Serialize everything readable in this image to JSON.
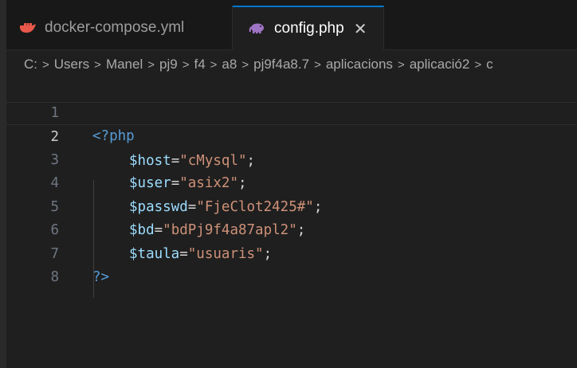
{
  "tabs": [
    {
      "label": "docker-compose.yml",
      "icon": "docker-whale-icon",
      "active": false
    },
    {
      "label": "config.php",
      "icon": "php-elephant-icon",
      "active": true,
      "close": "✕"
    }
  ],
  "breadcrumb": [
    "C:",
    "Users",
    "Manel",
    "pj9",
    "f4",
    "a8",
    "pj9f4a8.7",
    "aplicacions",
    "aplicació2",
    "c"
  ],
  "breadcrumb_separator": ">",
  "editor": {
    "current_line": 2,
    "lines": [
      {
        "num": "1",
        "open_tag": "<?php"
      },
      {
        "num": "2",
        "var": "$host",
        "eq": "=",
        "str": "\"cMysql\"",
        "semi": ";"
      },
      {
        "num": "3",
        "var": "$user",
        "eq": "=",
        "str": "\"asix2\"",
        "semi": ";"
      },
      {
        "num": "4",
        "var": "$passwd",
        "eq": "=",
        "str": "\"FjeClot2425#\"",
        "semi": ";"
      },
      {
        "num": "5",
        "var": "$bd",
        "eq": "=",
        "str": "\"bdPj9f4a87apl2\"",
        "semi": ";"
      },
      {
        "num": "6",
        "var": "$taula",
        "eq": "=",
        "str": "\"usuaris\"",
        "semi": ";"
      },
      {
        "num": "7",
        "close_tag": "?>"
      },
      {
        "num": "8"
      }
    ]
  },
  "colors": {
    "accent": "#0078d4",
    "docker_icon": "#e8584a",
    "php_icon": "#a074c4",
    "keyword": "#569cd6",
    "variable": "#9cdcfe",
    "string": "#ce9178"
  }
}
